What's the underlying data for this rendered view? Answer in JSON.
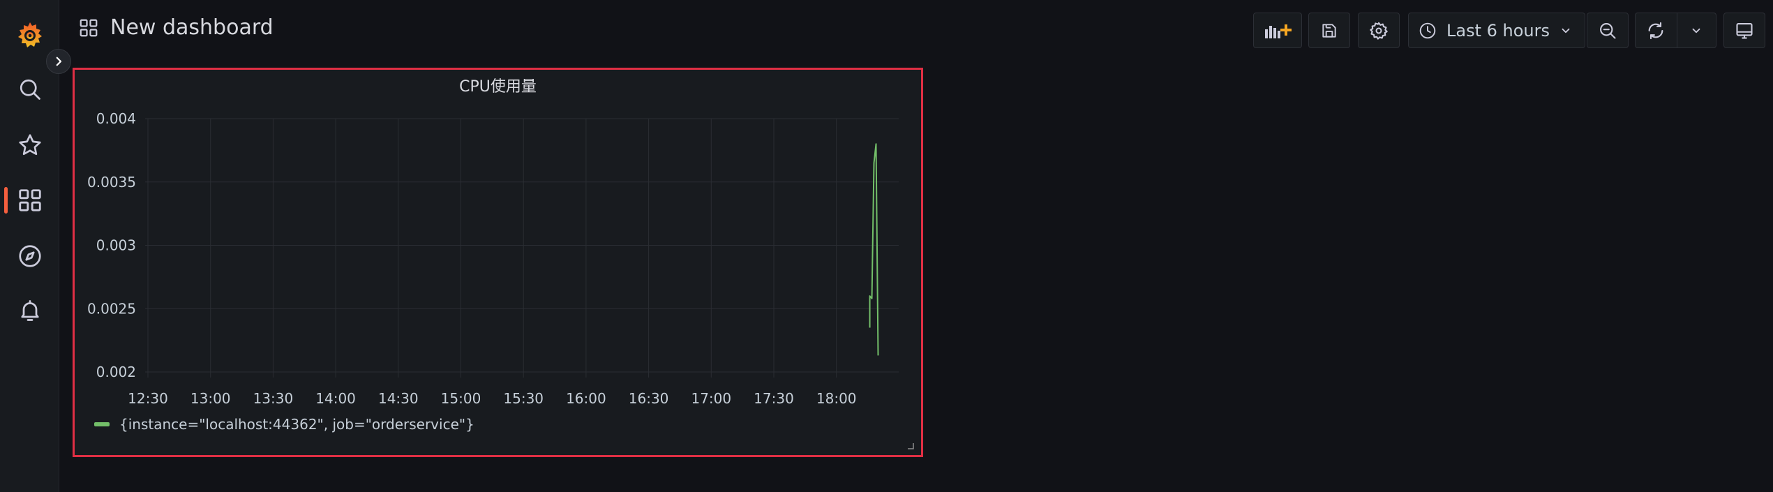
{
  "header": {
    "title": "New dashboard",
    "time_range": "Last 6 hours"
  },
  "sidebar": {
    "items": [
      {
        "icon": "grafana-logo-icon"
      },
      {
        "icon": "search-icon"
      },
      {
        "icon": "star-icon"
      },
      {
        "icon": "dashboards-icon",
        "active": true
      },
      {
        "icon": "explore-compass-icon"
      },
      {
        "icon": "alerting-bell-icon"
      }
    ]
  },
  "toolbar": {
    "buttons": [
      "add-panel-icon",
      "save-icon",
      "settings-icon",
      "time-picker",
      "zoom-out-icon",
      "refresh-icon",
      "refresh-interval-chevron",
      "tv-mode-icon"
    ]
  },
  "colors": {
    "accent": "#f55f3e",
    "series": "#73bf69",
    "panel_highlight": "#e02f44"
  },
  "panel": {
    "title": "CPU使用量",
    "legend": "{instance=\"localhost:44362\", job=\"orderservice\"}"
  },
  "chart_data": {
    "type": "line",
    "title": "CPU使用量",
    "xlabel": "",
    "ylabel": "",
    "x_ticks": [
      "12:30",
      "13:00",
      "13:30",
      "14:00",
      "14:30",
      "15:00",
      "15:30",
      "16:00",
      "16:30",
      "17:00",
      "17:30",
      "18:00"
    ],
    "y_ticks": [
      "0.004",
      "0.0035",
      "0.003",
      "0.0025",
      "0.002"
    ],
    "ylim": [
      0.002,
      0.004
    ],
    "grid": true,
    "legend_position": "bottom-left",
    "series": [
      {
        "name": "{instance=\"localhost:44362\", job=\"orderservice\"}",
        "points": [
          {
            "x": "18:16",
            "y": 0.00235
          },
          {
            "x": "18:16",
            "y": 0.0026
          },
          {
            "x": "18:17",
            "y": 0.00258
          },
          {
            "x": "18:18",
            "y": 0.00365
          },
          {
            "x": "18:19",
            "y": 0.0038
          },
          {
            "x": "18:20",
            "y": 0.00213
          }
        ]
      }
    ]
  }
}
